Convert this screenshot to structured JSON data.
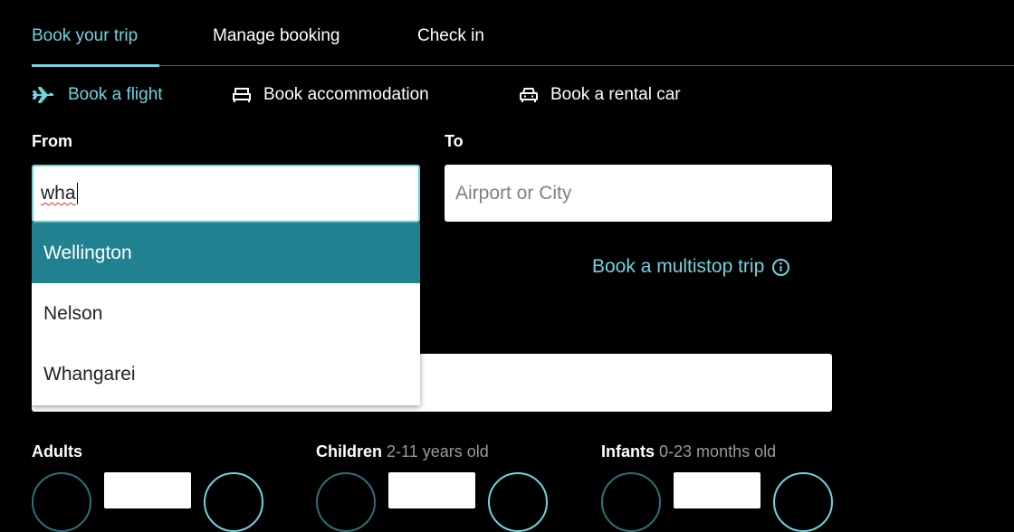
{
  "tabs": [
    {
      "label": "Book your trip",
      "active": true
    },
    {
      "label": "Manage booking",
      "active": false
    },
    {
      "label": "Check in",
      "active": false
    }
  ],
  "subtabs": [
    {
      "label": "Book a flight",
      "icon": "plane-icon",
      "active": true
    },
    {
      "label": "Book accommodation",
      "icon": "bed-icon",
      "active": false
    },
    {
      "label": "Book a rental car",
      "icon": "car-icon",
      "active": false
    }
  ],
  "from": {
    "label": "From",
    "value": "wha"
  },
  "to": {
    "label": "To",
    "placeholder": "Airport or City"
  },
  "suggestions": [
    {
      "label": "Wellington",
      "highlighted": true
    },
    {
      "label": "Nelson",
      "highlighted": false
    },
    {
      "label": "Whangarei",
      "highlighted": false
    }
  ],
  "multistop": {
    "label": "Book a multistop trip",
    "icon": "info-icon"
  },
  "passengers": {
    "adults": {
      "label": "Adults",
      "hint": ""
    },
    "children": {
      "label": "Children",
      "hint": "2-11 years old"
    },
    "infants": {
      "label": "Infants",
      "hint": "0-23 months old"
    }
  },
  "colors": {
    "accent": "#6fd3e0",
    "highlight": "#228190",
    "background": "#000000"
  }
}
